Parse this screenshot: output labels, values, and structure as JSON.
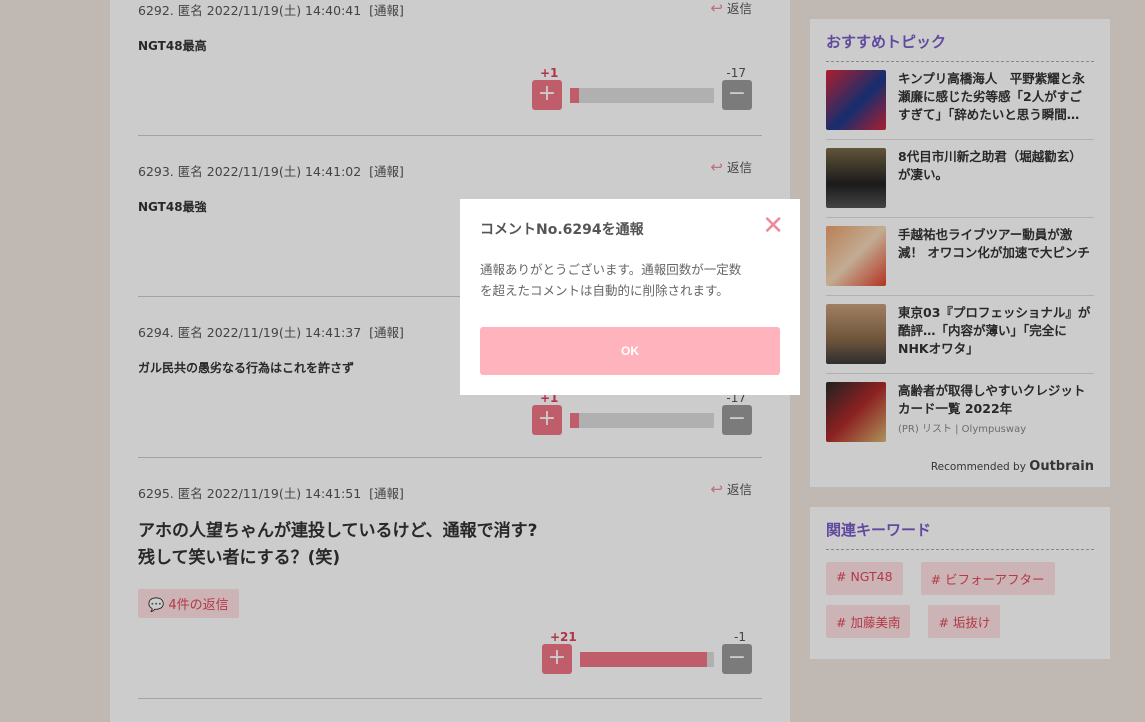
{
  "comments": [
    {
      "num": "6292.",
      "name": "匿名",
      "date": "2022/11/19(土) 14:40:41",
      "report": "[通報]",
      "reply": "返信",
      "body": "NGT48最高",
      "plus": "+1",
      "minus": "-17",
      "ratio": 0.06
    },
    {
      "num": "6293.",
      "name": "匿名",
      "date": "2022/11/19(土) 14:41:02",
      "report": "[通報]",
      "reply": "返信",
      "body": "NGT48最強"
    },
    {
      "num": "6294.",
      "name": "匿名",
      "date": "2022/11/19(土) 14:41:37",
      "report": "[通報]",
      "body": "ガル民共の愚劣なる行為はこれを許さず",
      "plus": "+1",
      "minus": "-17",
      "ratio": 0.06
    },
    {
      "num": "6295.",
      "name": "匿名",
      "date": "2022/11/19(土) 14:41:51",
      "report": "[通報]",
      "reply": "返信",
      "body_line1": "アホの人望ちゃんが連投しているけど、通報で消す?",
      "body_line2": "残して笑い者にする？(笑)",
      "replies": "4件の返信",
      "plus": "+21",
      "minus": "-1",
      "ratio": 0.95
    }
  ],
  "sidebar": {
    "topics_title": "おすすめトピック",
    "topics": [
      {
        "title": "キンプリ高橋海人　平野紫耀と永瀬廉に感じた劣等感「2人がすごすぎて」「辞めたいと思う瞬間…"
      },
      {
        "title": "8代目市川新之助君（堀越勸玄）が凄い。"
      },
      {
        "title": "手越祐也ライブツアー動員が激減！ オワコン化が加速で大ピンチ"
      },
      {
        "title": "東京03『プロフェッショナル』が酷評…「内容が薄い」「完全にNHKオワタ」"
      },
      {
        "title": "高齢者が取得しやすいクレジットカード一覧 2022年",
        "source": "(PR) リスト | Olympusway"
      }
    ],
    "recommended": "Recommended by",
    "outbrain": "Outbrain",
    "keywords_title": "関連キーワード",
    "keywords": [
      "# NGT48",
      "# ビフォーアフター",
      "# 加藤美南",
      "# 垢抜け"
    ]
  },
  "modal": {
    "title": "コメントNo.6294を通報",
    "line1": "通報ありがとうございます。通報回数が一定数",
    "line2": "を超えたコメントは自動的に削除されます。",
    "ok": "OK"
  },
  "colors": {
    "accent": "#f07585",
    "purple": "#7b5cc8",
    "ok": "#ffb3bc"
  }
}
